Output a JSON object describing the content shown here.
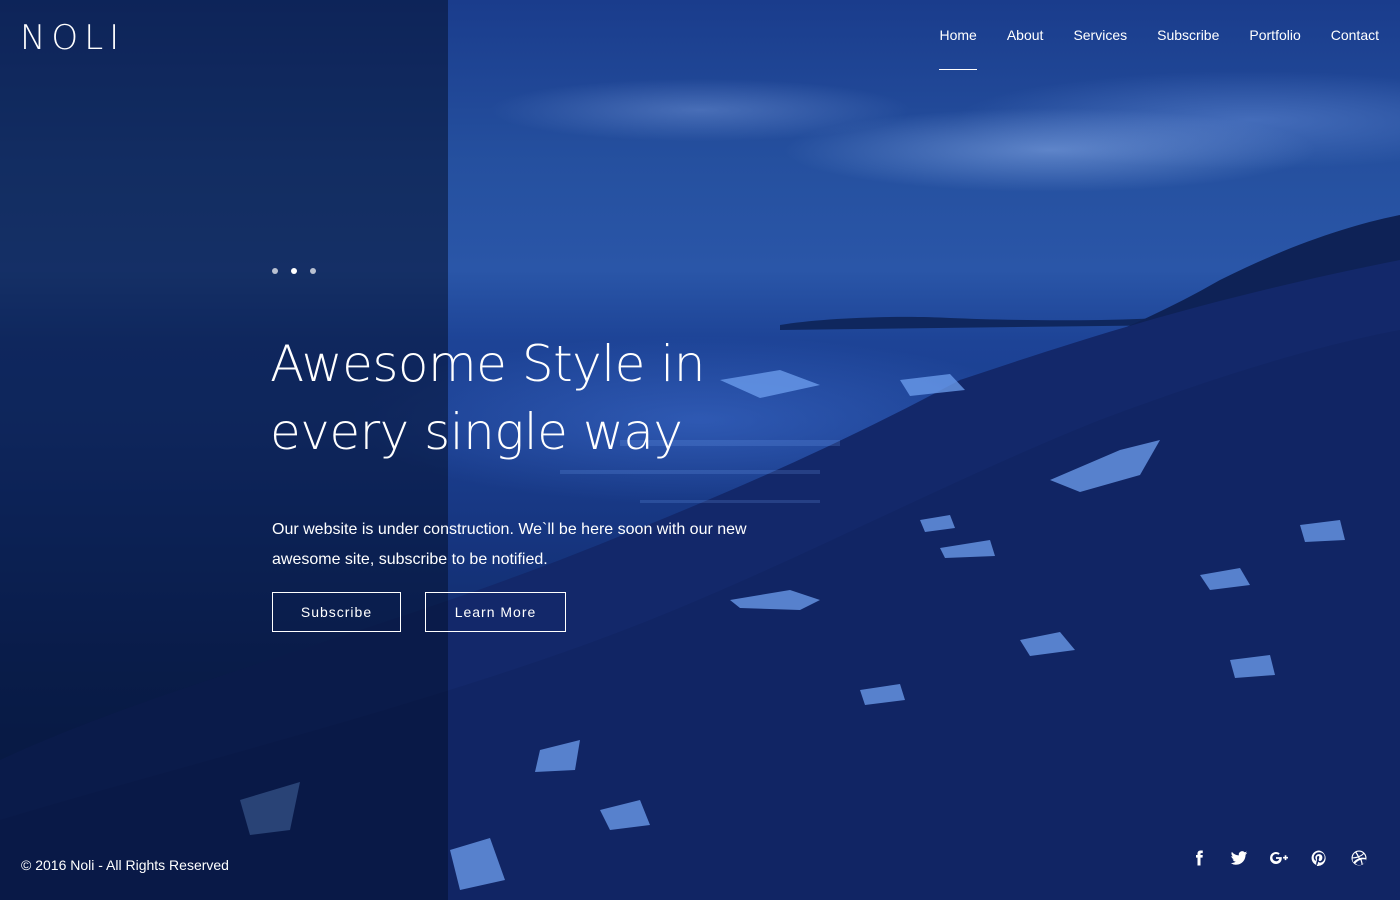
{
  "brand": {
    "logo": "NOLI"
  },
  "nav": {
    "items": [
      {
        "label": "Home",
        "active": true
      },
      {
        "label": "About",
        "active": false
      },
      {
        "label": "Services",
        "active": false
      },
      {
        "label": "Subscribe",
        "active": false
      },
      {
        "label": "Portfolio",
        "active": false
      },
      {
        "label": "Contact",
        "active": false
      }
    ]
  },
  "slider": {
    "dot_count": 3,
    "active_index": 1
  },
  "hero": {
    "headline_line1": "Awesome Style in",
    "headline_line2": "every single way",
    "lead_line1": "Our website is under construction. We`ll be here soon with our new",
    "lead_line2": "awesome site, subscribe to be notified.",
    "subscribe_label": "Subscribe",
    "learn_more_label": "Learn More"
  },
  "footer": {
    "copyright": "© 2016 Noli - All Rights Reserved",
    "social": [
      "facebook-icon",
      "twitter-icon",
      "google-plus-icon",
      "pinterest-icon",
      "dribbble-icon"
    ]
  },
  "colors": {
    "accent": "#ffffff",
    "background": "#1b3f90",
    "panel": "#031030"
  }
}
